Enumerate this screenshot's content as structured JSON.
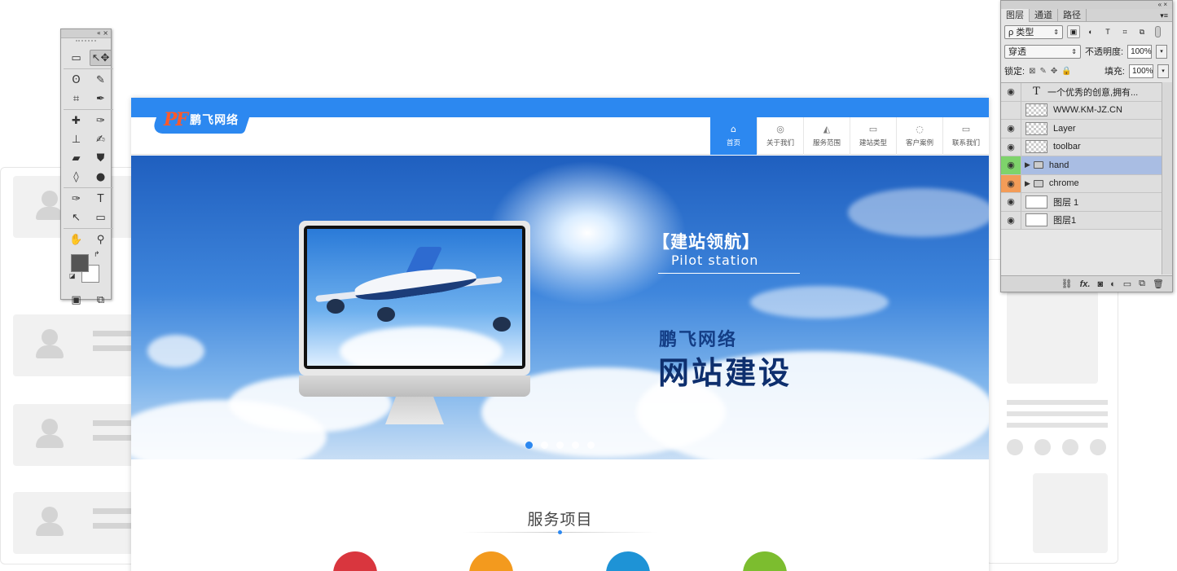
{
  "website": {
    "logo_mark": "PF",
    "logo_text": "鹏飞网络",
    "nav": [
      {
        "label": "首页",
        "icon": "⌂"
      },
      {
        "label": "关于我们",
        "icon": "◎"
      },
      {
        "label": "服务范围",
        "icon": "◭"
      },
      {
        "label": "建站类型",
        "icon": "▭"
      },
      {
        "label": "客户案例",
        "icon": "◌"
      },
      {
        "label": "联系我们",
        "icon": "▭"
      }
    ],
    "banner": {
      "title": "【建站领航】",
      "subtitle": "Pilot station",
      "brand_small": "鹏飞网络",
      "brand_big": "网站建设",
      "apple_glyph": "",
      "slides": 5,
      "active_slide": 1
    },
    "services": {
      "title": "服务项目",
      "circle_colors": [
        "#d9363e",
        "#f39a1e",
        "#1e93d6",
        "#7cbd2f"
      ]
    },
    "accent_color": "#2c88f0"
  },
  "ps_tools": {
    "title_controls": "«  ×",
    "tools": [
      "▭",
      "↖✥",
      "ʘ",
      "✎",
      "⌗",
      "✒",
      "✚",
      "✑",
      "⊥",
      "✍",
      "▰",
      "⛊",
      "◊",
      "●",
      "✑",
      "T",
      "↖",
      "▭",
      "✋",
      "⚲"
    ],
    "swap_icon": "↱",
    "default_icon": "◪",
    "bottom": [
      "▣",
      "⧉"
    ]
  },
  "ps_layers": {
    "title_controls": "«  ×",
    "tabs": [
      "图层",
      "通道",
      "路径"
    ],
    "menu_icon": "▾≡",
    "filter_label": "ρ 类型",
    "filter_icons": [
      "▣",
      "◐",
      "T",
      "⌗",
      "⧉"
    ],
    "blend_mode": "穿透",
    "opacity_label": "不透明度:",
    "opacity_value": "100%",
    "lock_label": "锁定:",
    "lock_icons": [
      "⊠",
      "✎",
      "✥",
      "🔒"
    ],
    "fill_label": "填充:",
    "fill_value": "100%",
    "layers": [
      {
        "name": "一个优秀的创意,拥有...",
        "type": "text",
        "visible": true
      },
      {
        "name": "WWW.KM-JZ.CN",
        "type": "transparent",
        "visible": false
      },
      {
        "name": "Layer",
        "type": "smart",
        "visible": true
      },
      {
        "name": "toolbar",
        "type": "smart",
        "visible": true
      },
      {
        "name": "hand",
        "type": "group",
        "visible": true,
        "eye_color": "green",
        "selected": true
      },
      {
        "name": "chrome",
        "type": "group",
        "visible": true,
        "eye_color": "orange"
      },
      {
        "name": "图层 1",
        "type": "white",
        "visible": true
      },
      {
        "name": "图层1",
        "type": "white",
        "visible": true
      }
    ],
    "bottom_icons": [
      "⛓",
      "fx.",
      "◙",
      "◐",
      "▭",
      "⧉",
      "🗑"
    ]
  }
}
